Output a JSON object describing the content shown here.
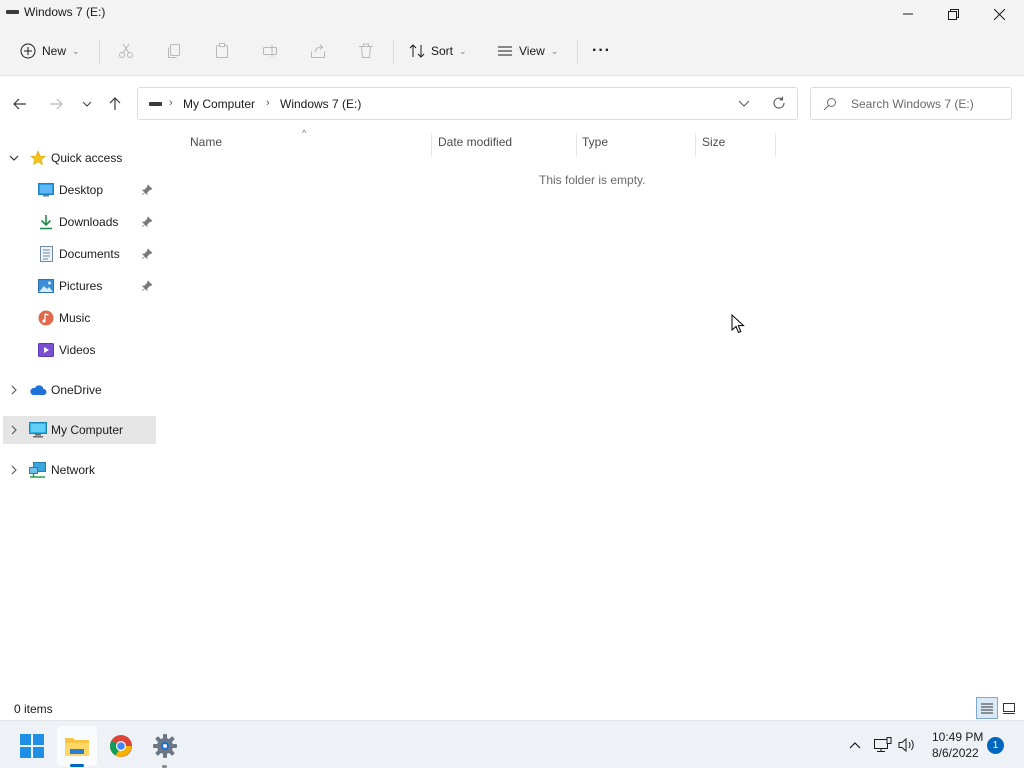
{
  "window": {
    "title": "Windows 7 (E:)"
  },
  "commandbar": {
    "new_label": "New",
    "sort_label": "Sort",
    "view_label": "View",
    "chevron": "⌄",
    "more_glyph": "···"
  },
  "address": {
    "crumbs": [
      "My Computer",
      "Windows 7 (E:)"
    ],
    "separator": "›"
  },
  "search": {
    "placeholder": "Search Windows 7 (E:)"
  },
  "sidebar": {
    "quick_access": "Quick access",
    "items": [
      {
        "label": "Desktop",
        "icon": "desktop-icon",
        "pinned": true
      },
      {
        "label": "Downloads",
        "icon": "downloads-icon",
        "pinned": true
      },
      {
        "label": "Documents",
        "icon": "documents-icon",
        "pinned": true
      },
      {
        "label": "Pictures",
        "icon": "pictures-icon",
        "pinned": true
      },
      {
        "label": "Music",
        "icon": "music-icon",
        "pinned": false
      },
      {
        "label": "Videos",
        "icon": "videos-icon",
        "pinned": false
      }
    ],
    "onedrive": "OneDrive",
    "my_computer": "My Computer",
    "network": "Network"
  },
  "columns": {
    "name": "Name",
    "date_modified": "Date modified",
    "type": "Type",
    "size": "Size"
  },
  "content": {
    "empty_message": "This folder is empty."
  },
  "statusbar": {
    "items_count": "0 items"
  },
  "taskbar": {
    "apps": [
      "start-icon",
      "file-explorer-icon",
      "chrome-icon",
      "settings-icon"
    ],
    "time": "10:49 PM",
    "date": "8/6/2022",
    "notification_count": "1"
  },
  "colors": {
    "accent": "#0067c0",
    "selected_bg": "#e5e5e5",
    "chrome_bg": "#f3f3f3"
  }
}
